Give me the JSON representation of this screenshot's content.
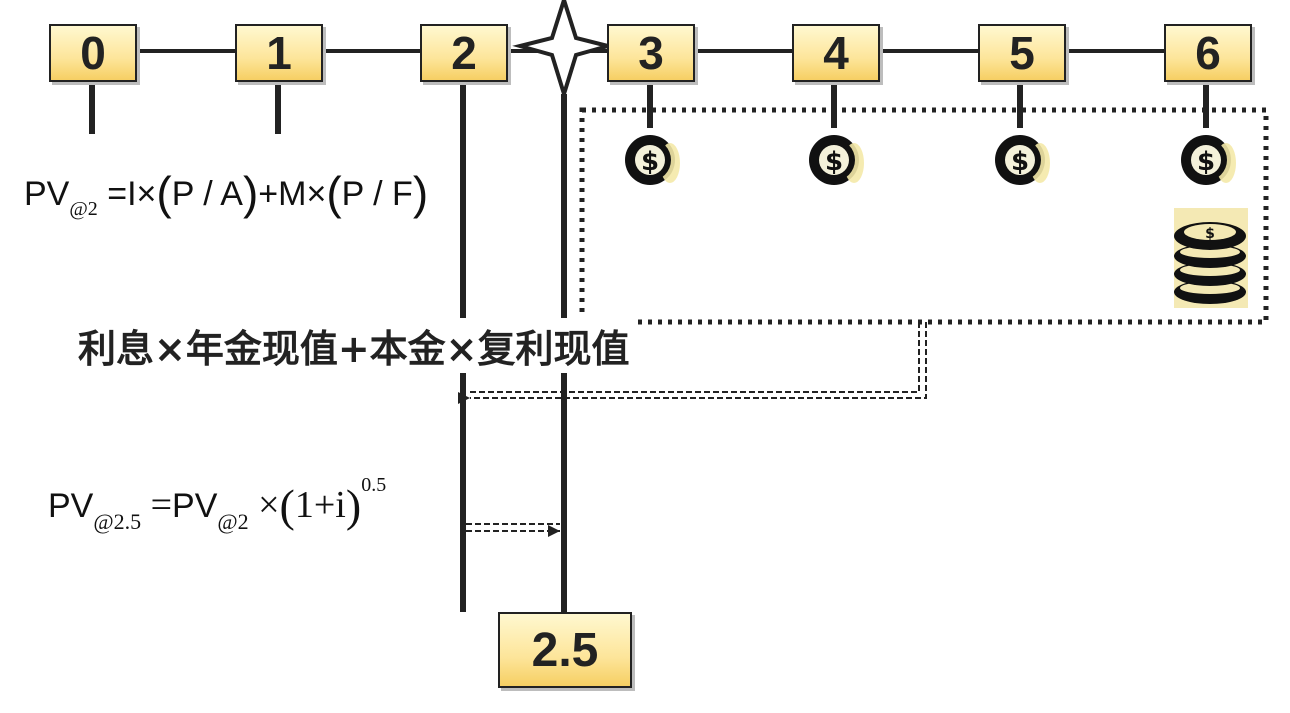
{
  "timeline": {
    "periods": [
      "0",
      "1",
      "2",
      "3",
      "4",
      "5",
      "6"
    ],
    "valuation_point": "2.5"
  },
  "formula_pv_at_2": {
    "lhs_main": "PV",
    "lhs_sub": "@2",
    "rhs_prefix": "=I×",
    "pa_left": "(",
    "pa_text": "P / A",
    "pa_right": ")",
    "rhs_middle": "+M×",
    "pf_left": "(",
    "pf_text": "P / F",
    "pf_right": ")"
  },
  "caption": "利息×年金现值+本金×复利现值",
  "formula_pv_at_25": {
    "lhs_main": "PV",
    "lhs_sub": "@2.5",
    "eq": "=",
    "rhs_main": "PV",
    "rhs_sub": "@2",
    "times": "×",
    "paren_left": "(",
    "base": "1+i",
    "paren_right": ")",
    "exponent": "0.5"
  },
  "icons": {
    "coin": "dollar-coin-icon",
    "coin_stack": "coin-stack-icon",
    "marker": "four-point-star-icon"
  },
  "colors": {
    "box_fill": "#fde59a",
    "line": "#222222"
  }
}
